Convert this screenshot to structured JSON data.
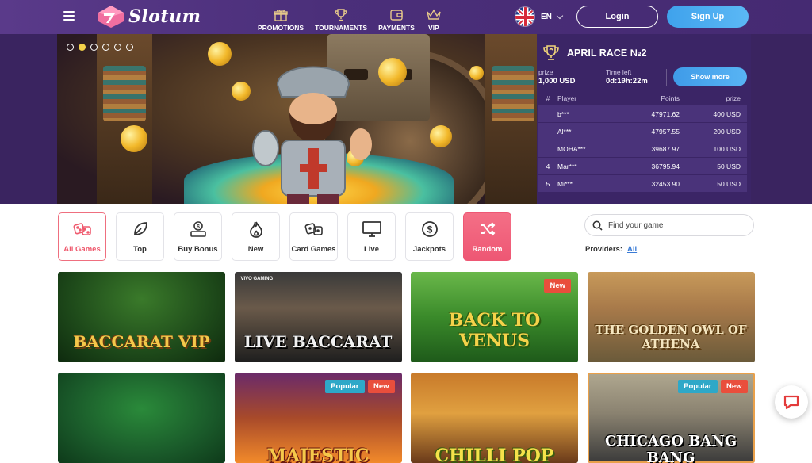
{
  "header": {
    "brand": "Slotum",
    "nav": [
      {
        "label": "PROMOTIONS",
        "icon": "gift-icon"
      },
      {
        "label": "TOURNAMENTS",
        "icon": "trophy-icon"
      },
      {
        "label": "PAYMENTS",
        "icon": "wallet-icon"
      },
      {
        "label": "VIP",
        "icon": "crown-icon"
      }
    ],
    "language": "EN",
    "login_label": "Login",
    "signup_label": "Sign Up"
  },
  "carousel": {
    "slide_count": 6,
    "active_index": 1
  },
  "race": {
    "title": "APRIL RACE №2",
    "prize_label": "prize",
    "prize_value": "1,000 USD",
    "time_label": "Time left",
    "time_value": "0d:19h:22m",
    "show_more_label": "Show more",
    "columns": [
      "#",
      "Player",
      "Points",
      "prize"
    ],
    "rows": [
      {
        "rank": "",
        "player": "b***",
        "points": "47971.62",
        "prize": "400 USD"
      },
      {
        "rank": "",
        "player": "Al***",
        "points": "47957.55",
        "prize": "200 USD"
      },
      {
        "rank": "",
        "player": "MOHA***",
        "points": "39687.97",
        "prize": "100 USD"
      },
      {
        "rank": "4",
        "player": "Mar***",
        "points": "36795.94",
        "prize": "50 USD"
      },
      {
        "rank": "5",
        "player": "Mi***",
        "points": "32453.90",
        "prize": "50 USD"
      }
    ]
  },
  "categories": [
    {
      "label": "All Games",
      "icon": "dice-icon",
      "state": "active"
    },
    {
      "label": "Top",
      "icon": "leaf-icon",
      "state": ""
    },
    {
      "label": "Buy Bonus",
      "icon": "bonus-icon",
      "state": ""
    },
    {
      "label": "New",
      "icon": "flame-icon",
      "state": ""
    },
    {
      "label": "Card Games",
      "icon": "cards-icon",
      "state": ""
    },
    {
      "label": "Live",
      "icon": "monitor-icon",
      "state": ""
    },
    {
      "label": "Jackpots",
      "icon": "dollar-coin-icon",
      "state": ""
    },
    {
      "label": "Random",
      "icon": "shuffle-icon",
      "state": "random"
    }
  ],
  "search": {
    "placeholder": "Find your game"
  },
  "providers": {
    "label": "Providers:",
    "value": "All"
  },
  "games": [
    {
      "title": "BACCARAT VIP",
      "badges": []
    },
    {
      "title": "LIVE BACCARAT",
      "provider_mark": "VIVO GAMING",
      "badges": []
    },
    {
      "title": "BACK TO VENUS",
      "badges": [
        "New"
      ]
    },
    {
      "title": "THE GOLDEN OWL OF ATHENA",
      "badges": []
    },
    {
      "title": "",
      "badges": []
    },
    {
      "title": "MAJESTIC",
      "badges": [
        "Popular",
        "New"
      ]
    },
    {
      "title": "CHILLI POP",
      "badges": []
    },
    {
      "title": "CHICAGO BANG BANG",
      "badges": [
        "Popular",
        "New"
      ]
    }
  ],
  "colors": {
    "header_bg": "#4b2f7a",
    "race_bg": "#3b2566",
    "signup_blue": "#3fa2ec",
    "accent_red": "#ef5a6e",
    "badge_new": "#e94e3c",
    "badge_popular": "#2ea8c8"
  }
}
